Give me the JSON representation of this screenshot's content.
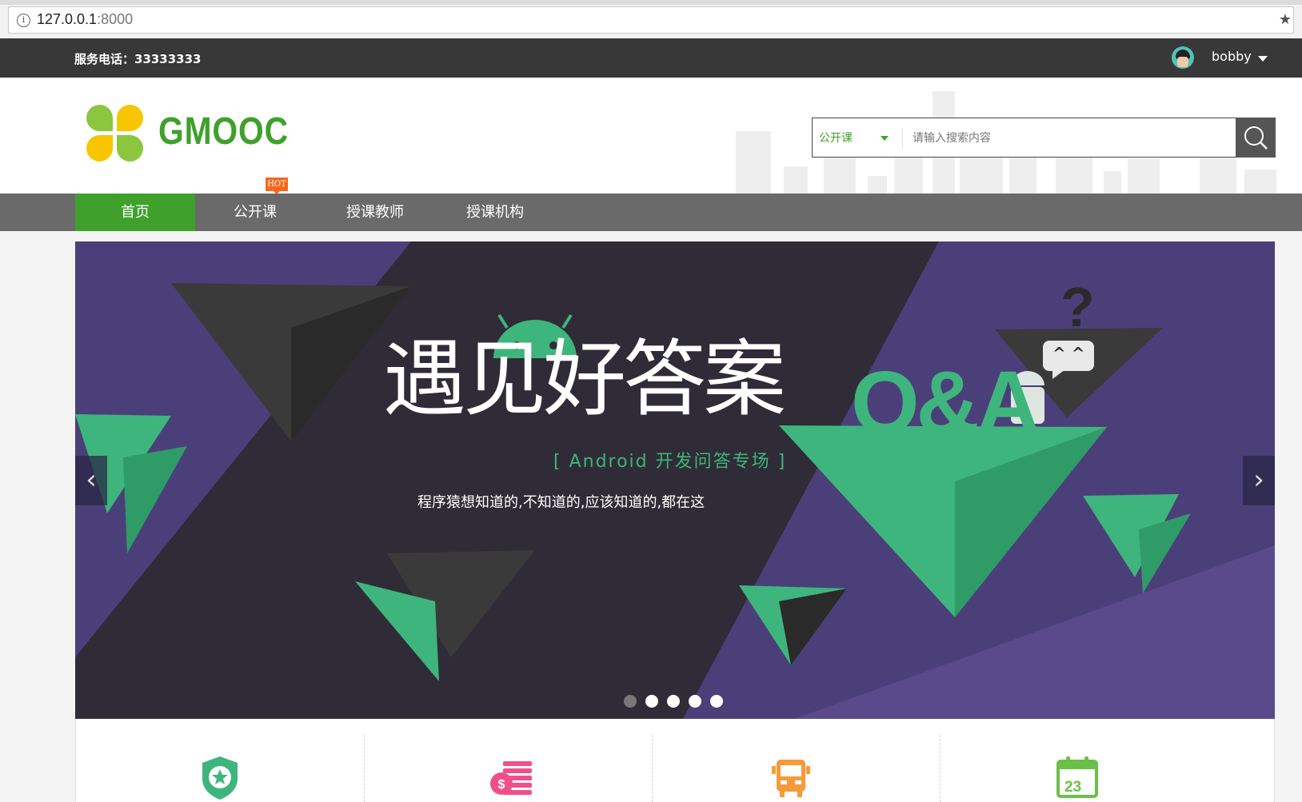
{
  "browser": {
    "info_icon": "info-icon",
    "url_host": "127.0.0.1",
    "url_port": ":8000",
    "star_icon": "★"
  },
  "topbar": {
    "phone_label": "服务电话：33333333",
    "username": "bobby"
  },
  "header": {
    "logo_text": "GMOOC",
    "search": {
      "type_label": "公开课",
      "placeholder": "请输入搜索内容"
    },
    "hot_badge": "HOT"
  },
  "nav": {
    "items": [
      {
        "label": "首页",
        "active": true
      },
      {
        "label": "公开课",
        "active": false
      },
      {
        "label": "授课教师",
        "active": false
      },
      {
        "label": "授课机构",
        "active": false
      }
    ]
  },
  "banner": {
    "headline": "遇见好答案",
    "subtitle": "[ Android 开发问答专场 ]",
    "tagline": "程序猿想知道的,不知道的,应该知道的,都在这",
    "qa_text": "Q&A",
    "question_mark": "?",
    "bubble_text": "^ ^",
    "prev_arrow": "‹",
    "next_arrow": "›",
    "slide_count": 5,
    "active_slide": 1,
    "colors": {
      "green": "#3eb57c",
      "purple": "#4b3f7a",
      "dark": "#2f2c37"
    }
  },
  "features": {
    "icons": [
      "shield-star-icon",
      "money-stack-icon",
      "bus-icon",
      "calendar-icon"
    ],
    "calendar_day": "23"
  },
  "colors": {
    "brand_green": "#3fa12c",
    "topbar": "#383838",
    "nav": "#6a6a6a",
    "hot": "#f5681c"
  }
}
